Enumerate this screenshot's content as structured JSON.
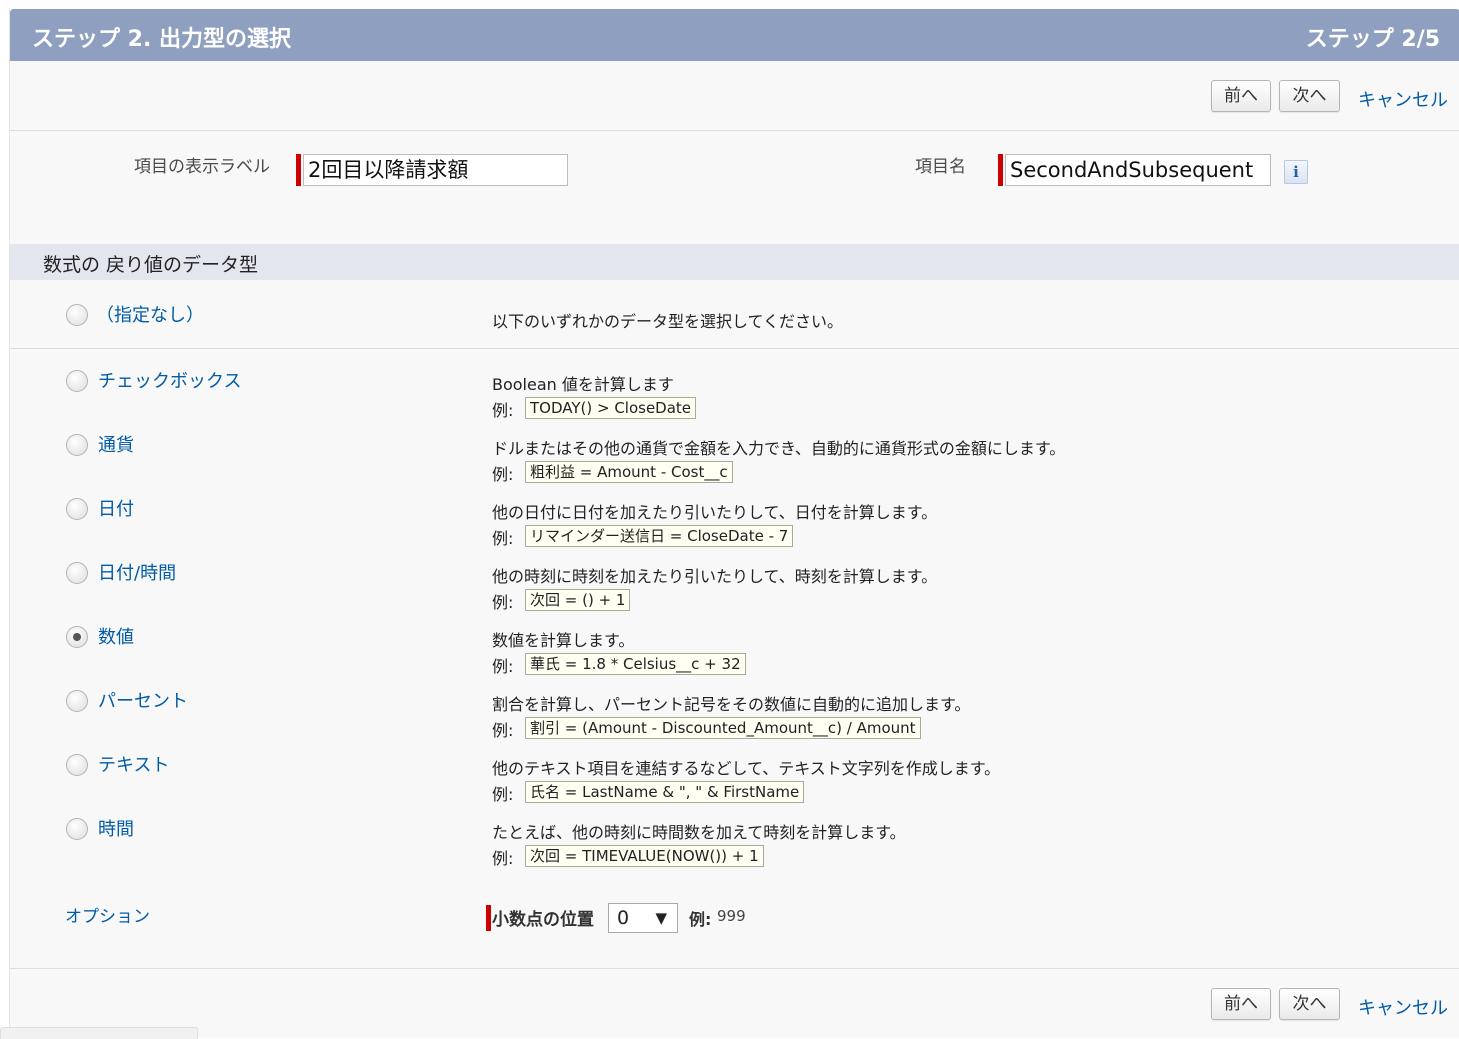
{
  "header": {
    "title": "ステップ 2. 出力型の選択",
    "step": "ステップ 2/5"
  },
  "nav": {
    "prev_label": "前へ",
    "next_label": "次へ",
    "cancel_label": "キャンセル"
  },
  "fields": {
    "label_caption": "項目の表示ラベル",
    "label_value": "2回目以降請求額",
    "name_caption": "項目名",
    "name_value": "SecondAndSubsequent",
    "info_icon": "i"
  },
  "section": {
    "title": "数式の 戻り値のデータ型"
  },
  "none_option": {
    "label": "（指定なし）",
    "description": "以下のいずれかのデータ型を選択してください。"
  },
  "example_prefix": "例:",
  "types": [
    {
      "label": "チェックボックス",
      "description": "Boolean 値を計算します",
      "example": "TODAY() > CloseDate",
      "selected": false
    },
    {
      "label": "通貨",
      "description": "ドルまたはその他の通貨で金額を入力でき、自動的に通貨形式の金額にします。",
      "example": "粗利益 = Amount - Cost__c",
      "selected": false
    },
    {
      "label": "日付",
      "description": "他の日付に日付を加えたり引いたりして、日付を計算します。",
      "example": "リマインダー送信日 = CloseDate - 7",
      "selected": false
    },
    {
      "label": "日付/時間",
      "description": "他の時刻に時刻を加えたり引いたりして、時刻を計算します。",
      "example": "次回 = () + 1",
      "selected": false
    },
    {
      "label": "数値",
      "description": "数値を計算します。",
      "example": "華氏 = 1.8 * Celsius__c + 32",
      "selected": true
    },
    {
      "label": "パーセント",
      "description": "割合を計算し、パーセント記号をその数値に自動的に追加します。",
      "example": "割引 = (Amount - Discounted_Amount__c) / Amount",
      "selected": false
    },
    {
      "label": "テキスト",
      "description": "他のテキスト項目を連結するなどして、テキスト文字列を作成します。",
      "example": "氏名 = LastName & \", \" & FirstName",
      "selected": false
    },
    {
      "label": "時間",
      "description": "たとえば、他の時刻に時間数を加えて時刻を計算します。",
      "example": "次回 = TIMEVALUE(NOW()) + 1",
      "selected": false
    }
  ],
  "options": {
    "label": "オプション",
    "decimal_label": "小数点の位置",
    "decimal_value": "0",
    "example_label": "例:",
    "example_value": "999"
  },
  "colors": {
    "header_bg": "#8f9fc0",
    "link": "#015ba7",
    "required": "#cc0000",
    "section_bg": "#e3e6ef"
  }
}
